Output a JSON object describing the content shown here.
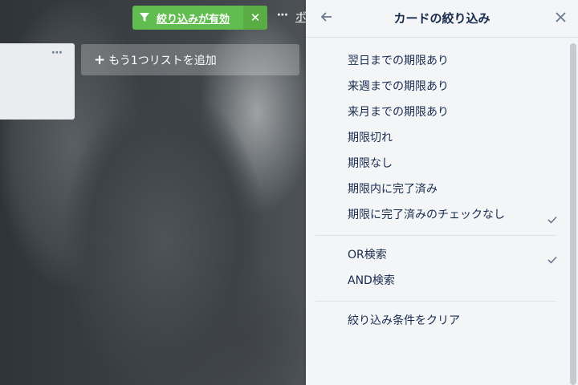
{
  "header": {
    "filter_label": "絞り込みが有効",
    "filter_clear": "✕",
    "more": "⋯",
    "board_menu_partial": "ボ"
  },
  "list": {
    "menu_dots": "⋯"
  },
  "add_list": {
    "plus": "+",
    "label": "もう1つリストを追加"
  },
  "panel": {
    "title": "カードの絞り込み",
    "back": "←",
    "close": "✕",
    "due_items": [
      {
        "label": "翌日までの期限あり",
        "checked": false
      },
      {
        "label": "来週までの期限あり",
        "checked": false
      },
      {
        "label": "来月までの期限あり",
        "checked": false
      },
      {
        "label": "期限切れ",
        "checked": false
      },
      {
        "label": "期限なし",
        "checked": false
      },
      {
        "label": "期限内に完了済み",
        "checked": false
      },
      {
        "label": "期限に完了済みのチェックなし",
        "checked": true
      }
    ],
    "mode_items": [
      {
        "label": "OR検索",
        "checked": true
      },
      {
        "label": "AND検索",
        "checked": false
      }
    ],
    "clear_label": "絞り込み条件をクリア"
  },
  "colors": {
    "filter_green": "#61bd4f",
    "panel_bg": "#f4f5f7",
    "text": "#172b4d",
    "muted": "#6b778c"
  }
}
